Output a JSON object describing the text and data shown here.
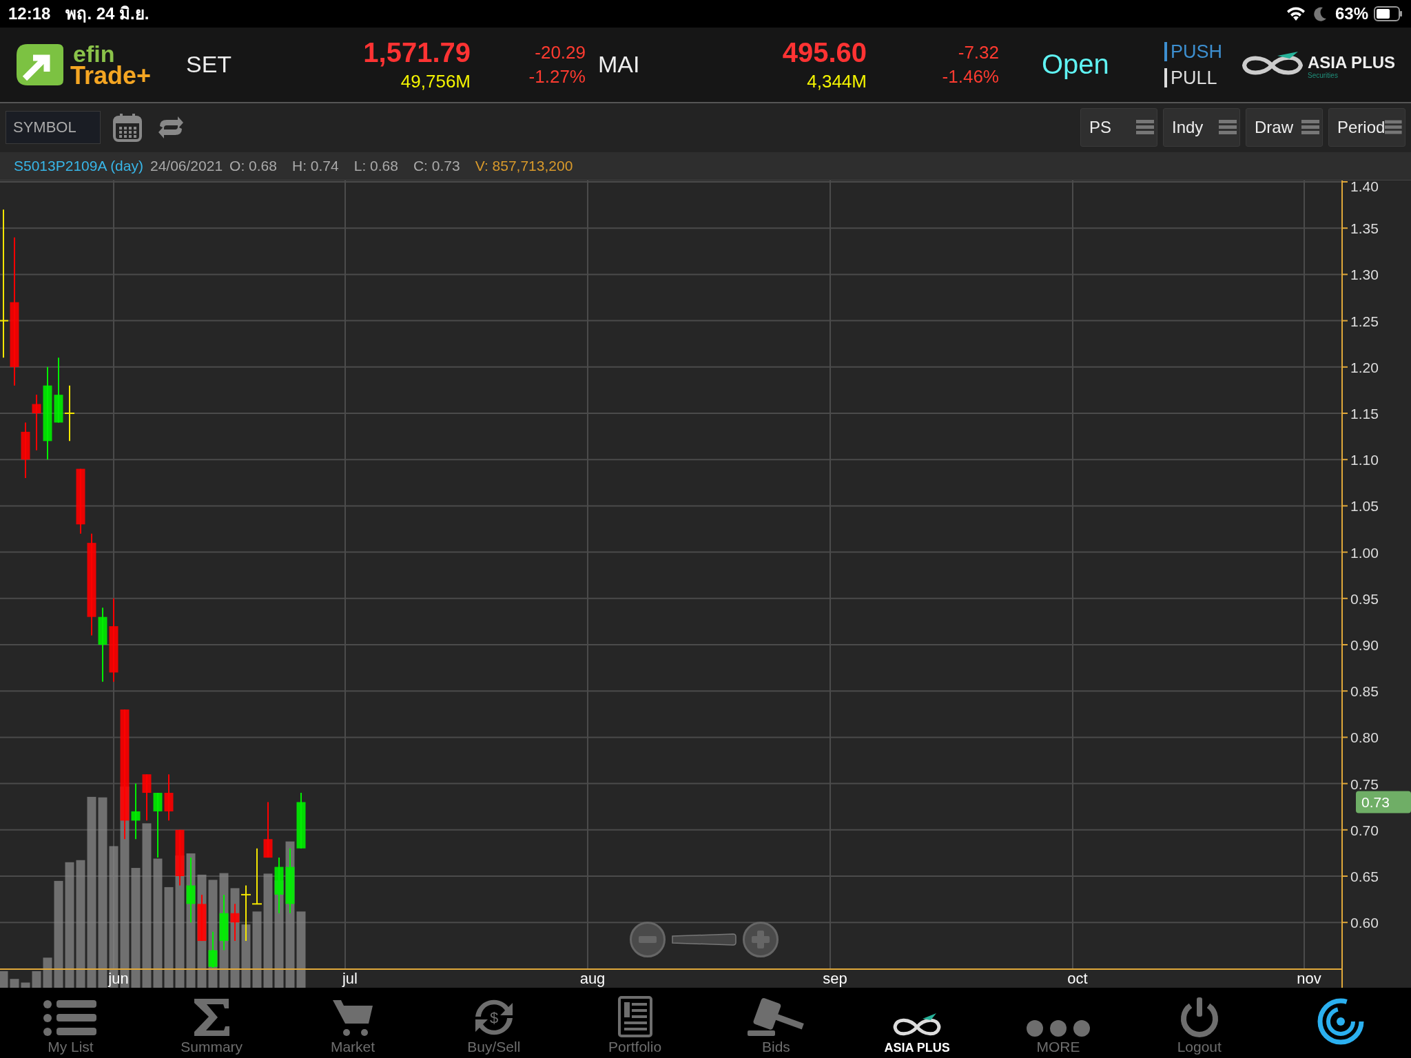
{
  "status_bar": {
    "time": "12:18",
    "date": "พฤ. 24 มิ.ย.",
    "battery": "63%"
  },
  "header": {
    "logo": {
      "line_1": "efin",
      "line_2": "Trade+"
    },
    "markets": [
      {
        "name": "SET",
        "index": "1,571.79",
        "value": "49,756M",
        "change": "-20.29",
        "change_pct": "-1.27%"
      },
      {
        "name": "MAI",
        "index": "495.60",
        "value": "4,344M",
        "change": "-7.32",
        "change_pct": "-1.46%"
      }
    ],
    "market_status": "Open",
    "modes": [
      {
        "label": "PUSH",
        "selected": true
      },
      {
        "label": "PULL",
        "selected": false
      }
    ],
    "broker": {
      "name": "ASIA PLUS",
      "tagline": "Securities"
    }
  },
  "toolbar": {
    "symbol_placeholder": "SYMBOL",
    "buttons": [
      "PS",
      "Indy",
      "Draw",
      "Period"
    ]
  },
  "info": {
    "symbol": "S5013P2109A (day)",
    "date": "24/06/2021",
    "fields": [
      {
        "label": "O:",
        "value": "0.68"
      },
      {
        "label": "H:",
        "value": "0.74"
      },
      {
        "label": "L:",
        "value": "0.68"
      },
      {
        "label": "C:",
        "value": "0.73"
      }
    ],
    "volume": {
      "label": "V:",
      "value": "857,713,200"
    }
  },
  "chart": {
    "last_price": "0.73",
    "chart_data": {
      "type": "candlestick",
      "grid": true,
      "ylim": [
        0.55,
        1.4
      ],
      "categories": [
        null,
        null,
        null,
        null,
        null,
        null,
        null,
        null,
        null,
        null,
        "jun",
        null,
        null,
        null,
        null,
        null,
        null,
        null,
        null,
        null,
        null,
        null,
        null,
        null,
        null,
        null,
        null,
        null,
        null,
        null,
        null,
        "jul",
        null,
        null,
        null,
        null,
        null,
        null,
        null,
        null,
        null,
        null,
        null,
        null,
        null,
        null,
        null,
        null,
        null,
        null,
        null,
        null,
        null,
        "aug",
        null,
        null,
        null,
        null,
        null,
        null,
        null,
        null,
        null,
        null,
        null,
        null,
        null,
        null,
        null,
        null,
        null,
        null,
        null,
        null,
        null,
        "sep",
        null,
        null,
        null,
        null,
        null,
        null,
        null,
        null,
        null,
        null,
        null,
        null,
        null,
        null,
        null,
        null,
        null,
        null,
        null,
        null,
        null,
        "oct",
        null,
        null,
        null,
        null,
        null,
        null,
        null,
        null,
        null,
        null,
        null,
        null,
        null,
        null,
        null,
        null,
        null,
        null,
        null,
        null,
        "nov",
        null,
        null,
        null
      ],
      "yticks": [
        {
          "value": 1.4,
          "label": "1.40"
        },
        {
          "value": 1.35,
          "label": "1.35"
        },
        {
          "value": 1.3,
          "label": "1.30"
        },
        {
          "value": 1.25,
          "label": "1.25"
        },
        {
          "value": 1.2,
          "label": "1.20"
        },
        {
          "value": 1.15,
          "label": "1.15"
        },
        {
          "value": 1.1,
          "label": "1.10"
        },
        {
          "value": 1.05,
          "label": "1.05"
        },
        {
          "value": 1.0,
          "label": "1.00"
        },
        {
          "value": 0.95,
          "label": "0.95"
        },
        {
          "value": 0.9,
          "label": "0.90"
        },
        {
          "value": 0.85,
          "label": "0.85"
        },
        {
          "value": 0.8,
          "label": "0.80"
        },
        {
          "value": 0.75,
          "label": "0.75"
        },
        {
          "value": 0.7,
          "label": "0.70"
        },
        {
          "value": 0.65,
          "label": "0.65"
        },
        {
          "value": 0.6,
          "label": "0.60"
        }
      ],
      "ohlc": [
        [
          1.25,
          1.37,
          1.21,
          1.25
        ],
        [
          1.27,
          1.34,
          1.18,
          1.2
        ],
        [
          1.13,
          1.14,
          1.08,
          1.1
        ],
        [
          1.16,
          1.17,
          1.11,
          1.15
        ],
        [
          1.12,
          1.2,
          1.1,
          1.18
        ],
        [
          1.14,
          1.21,
          1.14,
          1.17
        ],
        [
          1.15,
          1.18,
          1.12,
          1.15
        ],
        [
          1.09,
          1.09,
          1.02,
          1.03
        ],
        [
          1.01,
          1.02,
          0.91,
          0.93
        ],
        [
          0.9,
          0.94,
          0.86,
          0.93
        ],
        [
          0.92,
          0.95,
          0.86,
          0.87
        ],
        [
          0.83,
          0.83,
          0.69,
          0.71
        ],
        [
          0.71,
          0.75,
          0.69,
          0.72
        ],
        [
          0.76,
          0.76,
          0.71,
          0.74
        ],
        [
          0.72,
          0.74,
          0.67,
          0.74
        ],
        [
          0.74,
          0.76,
          0.71,
          0.72
        ],
        [
          0.7,
          0.7,
          0.64,
          0.65
        ],
        [
          0.62,
          0.67,
          0.6,
          0.64
        ],
        [
          0.62,
          0.63,
          0.58,
          0.58
        ],
        [
          0.552,
          0.59,
          0.551,
          0.57
        ],
        [
          0.58,
          0.63,
          0.57,
          0.61
        ],
        [
          0.61,
          0.62,
          0.58,
          0.6
        ],
        [
          0.63,
          0.64,
          0.58,
          0.63
        ],
        [
          0.62,
          0.68,
          0.62,
          0.62
        ],
        [
          0.69,
          0.73,
          0.67,
          0.67
        ],
        [
          0.63,
          0.67,
          0.61,
          0.66
        ],
        [
          0.62,
          0.68,
          0.61,
          0.66
        ],
        [
          0.68,
          0.74,
          0.68,
          0.73
        ],
        null,
        null,
        null,
        null,
        null,
        null,
        null,
        null,
        null,
        null,
        null,
        null,
        null,
        null,
        null,
        null,
        null,
        null,
        null,
        null,
        null,
        null,
        null,
        null,
        null,
        null,
        null,
        null,
        null,
        null,
        null,
        null,
        null,
        null,
        null,
        null,
        null,
        null,
        null,
        null,
        null,
        null,
        null,
        null,
        null,
        null,
        null,
        null,
        null,
        null,
        null,
        null,
        null,
        null,
        null,
        null,
        null,
        null,
        null,
        null,
        null,
        null,
        null,
        null,
        null,
        null,
        null,
        null,
        null,
        null,
        null,
        null,
        null,
        null,
        null,
        null,
        null,
        null,
        null,
        null,
        null,
        null,
        null,
        null,
        null,
        null,
        null,
        null,
        null,
        null,
        null,
        null,
        null,
        null
      ]
    }
  },
  "nav": [
    {
      "kind": "list",
      "label": "My List"
    },
    {
      "kind": "sigma",
      "label": "Summary"
    },
    {
      "kind": "cart",
      "label": "Market"
    },
    {
      "kind": "exchange",
      "label": "Buy/Sell",
      "symbol": "$"
    },
    {
      "kind": "document",
      "label": "Portfolio"
    },
    {
      "kind": "gavel",
      "label": "Bids"
    },
    {
      "kind": "logo",
      "label": "ASIA PLUS"
    },
    {
      "kind": "dots",
      "label": "MORE"
    },
    {
      "kind": "power",
      "label": "Logout"
    },
    {
      "kind": "ring"
    }
  ]
}
